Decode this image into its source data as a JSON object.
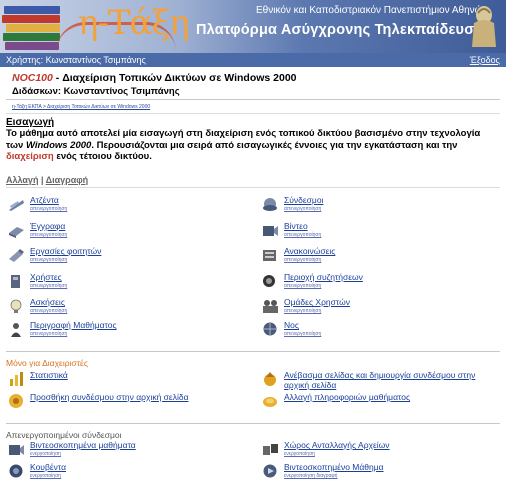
{
  "header": {
    "logo_text": "η-Τάξη",
    "university": "Εθνικόν και Καποδιστριακόν Πανεπιστήμιον Αθηνών",
    "platform": "Πλατφόρμα Ασύγχρονης Τηλεκπαίδευσης"
  },
  "userbar": {
    "user": "Χρήστης: Κωνσταντίνος Τσιμπάνης",
    "exit": "Έξοδος"
  },
  "course": {
    "code": "NOC100",
    "title": " - Διαχείριση Τοπικών Δικτύων σε Windows 2000",
    "instructor": "Διδάσκων: Κωνσταντίνος Τσιμπάνης"
  },
  "breadcrumb": {
    "home": "η-Τάξη ΕΚΠΑ",
    "sep": " > ",
    "current": "Διαχείριση Τοπικών Δικτύων σε Windows 2000"
  },
  "intro": {
    "heading": "Εισαγωγή",
    "p1": "Το μάθημα αυτό αποτελεί μία εισαγωγή στη διαχείριση ενός τοπικού δικτύου βασισμένο στην τεχνολογία των ",
    "p1_italic": "Windows 2000",
    "p2": ". Περουσιάζονται μια σειρά από εισαγωγικές έννοιες για την εγκατάσταση και την ",
    "p2_red": "διαχείριση",
    "p3": " ενός τέτοιου δικτύου."
  },
  "edit_links": {
    "edit": "Αλλαγή",
    "sep": " | ",
    "delete": "Διαγραφή"
  },
  "tools_left": [
    {
      "name": "Ατζέντα",
      "sub": "απενεργοποίηση",
      "icon": "agenda-icon"
    },
    {
      "name": "Έγγραφα",
      "sub": "απενεργοποίηση",
      "icon": "documents-icon"
    },
    {
      "name": "Εργασίες φοιτητών",
      "sub": "απενεργοποίηση",
      "icon": "assignments-icon"
    },
    {
      "name": "Χρήστες",
      "sub": "απενεργοποίηση",
      "icon": "users-icon"
    },
    {
      "name": "Ασκήσεις",
      "sub": "απενεργοποίηση",
      "icon": "exercises-icon"
    },
    {
      "name": "Περιγραφή Μαθήματος",
      "sub": "απενεργοποίηση",
      "icon": "description-icon"
    }
  ],
  "tools_right": [
    {
      "name": "Σύνδεσμοι",
      "sub": "απενεργοποίηση",
      "icon": "links-icon"
    },
    {
      "name": "Βίντεο",
      "sub": "απενεργοποίηση",
      "icon": "video-icon"
    },
    {
      "name": "Ανακοινώσεις",
      "sub": "απενεργοποίηση",
      "icon": "announcements-icon"
    },
    {
      "name": "Περιοχή συζητήσεων",
      "sub": "απενεργοποίηση",
      "icon": "forum-icon"
    },
    {
      "name": "Ομάδες Χρηστών",
      "sub": "απενεργοποίηση",
      "icon": "groups-icon"
    },
    {
      "name": "Νος",
      "sub": "απενεργοποίηση",
      "icon": "globe-icon"
    }
  ],
  "admin": {
    "heading": "Μόνο για Διαχειριστές",
    "items": [
      {
        "name": "Στατιστικά",
        "icon": "statistics-icon"
      },
      {
        "name": "Ανέβασμα σελίδας και δημιουργία συνδέσμου στην αρχική σελίδα",
        "icon": "upload-page-icon"
      },
      {
        "name": "Προσθήκη συνδέσμου στην αρχική σελίδα",
        "icon": "add-link-icon"
      },
      {
        "name": "Αλλαγή πληροφοριών μαθήματος",
        "icon": "course-info-icon"
      }
    ]
  },
  "inactive": {
    "heading": "Απενεργοποιημένοι σύνδεσμοι",
    "items": [
      {
        "name": "Βιντεοσκοπημένα μαθήματα",
        "sub": "ενεργοποίηση",
        "icon": "recorded-lessons-icon"
      },
      {
        "name": "Χώρος Ανταλλαγής Αρχείων",
        "sub": "ενεργοποίηση",
        "icon": "file-exchange-icon"
      },
      {
        "name": "Κουβέντα",
        "sub": "ενεργοποίηση",
        "icon": "chat-icon"
      },
      {
        "name": "Βιντεοσκοπημένο Μάθημα",
        "sub": "ενεργοποίηση διαγραφή",
        "icon": "recorded-lesson-icon"
      }
    ]
  },
  "colors": {
    "banner_dark": "#3f5c98",
    "userbar": "#4b6aa8",
    "link": "#1a3f9a",
    "accent_red": "#c0392b",
    "admin_orange": "#d9731f"
  }
}
